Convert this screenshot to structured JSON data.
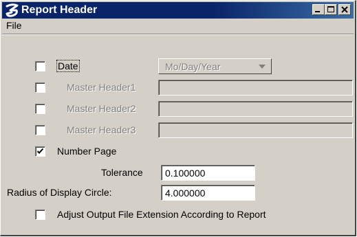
{
  "window": {
    "title": "Report Header",
    "title_bar_color": "#0a246a",
    "face_color": "#d4d0c8"
  },
  "menu": {
    "items": [
      "File"
    ]
  },
  "date": {
    "label": "Date",
    "checked": false,
    "format_value": "Mo/Day/Year"
  },
  "master_headers": [
    {
      "label": "Master Header1",
      "value": "",
      "checked": false
    },
    {
      "label": "Master Header2",
      "value": "",
      "checked": false
    },
    {
      "label": "Master Header3",
      "value": "",
      "checked": false
    }
  ],
  "number_page": {
    "label": "Number Page",
    "checked": true
  },
  "tolerance": {
    "label": "Tolerance",
    "value": "0.100000"
  },
  "radius": {
    "label": "Radius of Display Circle:",
    "value": "4.000000"
  },
  "adjust_extension": {
    "label": "Adjust Output File Extension According to Report",
    "checked": false
  }
}
